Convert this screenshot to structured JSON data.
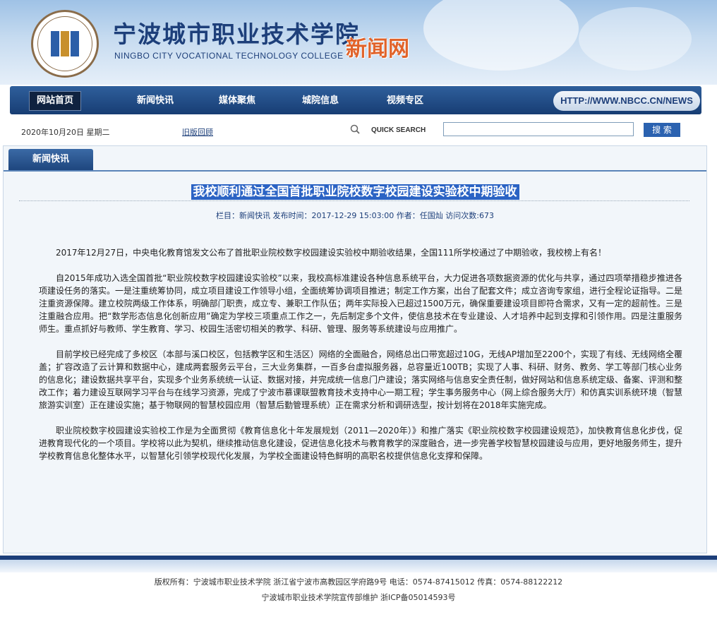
{
  "header": {
    "title_cn": "宁波城市职业技术学院",
    "title_en": "NINGBO CITY VOCATIONAL TECHNOLOGY COLLEGE",
    "subsite": "新闻网"
  },
  "nav": {
    "items": [
      {
        "label": "网站首页"
      },
      {
        "label": "新闻快讯"
      },
      {
        "label": "媒体聚焦"
      },
      {
        "label": "城院信息"
      },
      {
        "label": "视频专区"
      }
    ],
    "url": "HTTP://WWW.NBCC.CN/NEWS"
  },
  "toolbar": {
    "date": "2020年10月20日 星期二",
    "old_link": "旧版回顾",
    "search_label": "QUICK SEARCH",
    "search_value": "",
    "search_button": "搜 索"
  },
  "panel": {
    "tab": "新闻快讯"
  },
  "article": {
    "title": "我校顺利通过全国首批职业院校数字校园建设实验校中期验收",
    "meta": "栏目：新闻快讯  发布时间：2017-12-29 15:03:00  作者：任国灿  访问次数:673",
    "paragraphs": [
      "2017年12月27日，中央电化教育馆发文公布了首批职业院校数字校园建设实验校中期验收结果，全国111所学校通过了中期验收，我校榜上有名！",
      "自2015年成功入选全国首批“职业院校数字校园建设实验校”以来，我校高标准建设各种信息系统平台，大力促进各项数据资源的优化与共享，通过四项举措稳步推进各项建设任务的落实。一是注重统筹协同，成立项目建设工作领导小组，全面统筹协调项目推进；制定工作方案，出台了配套文件；成立咨询专家组，进行全程论证指导。二是注重资源保障。建立校院两级工作体系，明确部门职责，成立专、兼职工作队伍；两年实际投入已超过1500万元，确保重要建设项目即符合需求，又有一定的超前性。三是注重融合应用。把“数学形态信息化创新应用”确定为学校三项重点工作之一，先后制定多个文件，使信息技术在专业建设、人才培养中起到支撑和引领作用。四是注重服务师生。重点抓好与教师、学生教育、学习、校园生活密切相关的教学、科研、管理、服务等系统建设与应用推广。",
      "目前学校已经完成了多校区（本部与溪口校区，包括教学区和生活区）网络的全面融合，网络总出口带宽超过10G，无线AP增加至2200个，实现了有线、无线网络全覆盖；扩容改造了云计算和数据中心，建成两套服务云平台，三大业务集群，一百多台虚拟服务器，总容量近100TB；实现了人事、科研、财务、教务、学工等部门核心业务的信息化；建设数据共享平台，实现多个业务系统统一认证、数据对接，并完成统一信息门户建设；落实网络与信息安全责任制，做好网站和信息系统定级、备案、评测和整改工作；着力建设互联网学习平台与在线学习资源，完成了宁波市慕课联盟教育技术支持中心一期工程；学生事务服务中心（网上综合服务大厅）和仿真实训系统环境（智慧旅游实训室）正在建设实施；基于物联网的智慧校园应用（智慧后勤管理系统）正在需求分析和调研选型，按计划将在2018年实施完成。",
      "职业院校数字校园建设实验校工作是为全面贯彻《教育信息化十年发展规划（2011—2020年）》和推广落实《职业院校数字校园建设规范》，加快教育信息化步伐，促进教育现代化的一个项目。学校将以此为契机，继续推动信息化建设，促进信息化技术与教育教学的深度融合，进一步完善学校智慧校园建设与应用，更好地服务师生，提升学校教育信息化整体水平，以智慧化引领学校现代化发展，为学校全面建设特色鲜明的高职名校提供信息化支撑和保障。"
    ]
  },
  "footer": {
    "line1": "版权所有：宁波城市职业技术学院 浙江省宁波市高教园区学府路9号 电话：0574-87415012 传真：0574-88122212",
    "line2": "宁波城市职业技术学院宣传部维护 浙ICP备05014593号"
  }
}
